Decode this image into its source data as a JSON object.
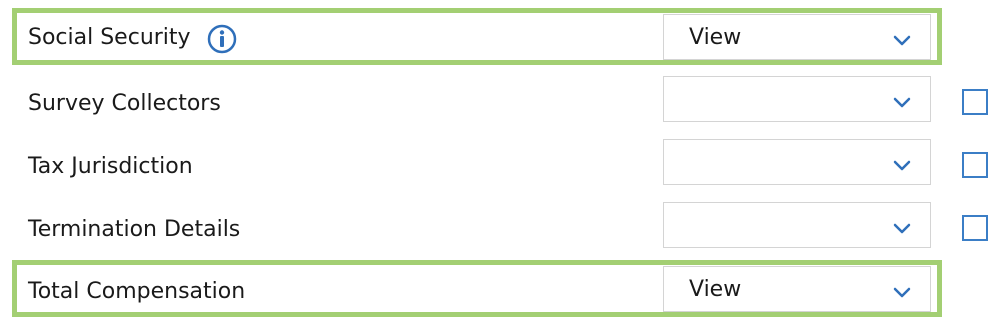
{
  "rows": [
    {
      "label": "Social Security",
      "value": "View",
      "highlighted": true,
      "has_info_icon": true,
      "has_checkbox": false
    },
    {
      "label": "Survey Collectors",
      "value": "",
      "highlighted": false,
      "has_info_icon": false,
      "has_checkbox": true,
      "checked": false
    },
    {
      "label": "Tax Jurisdiction",
      "value": "",
      "highlighted": false,
      "has_info_icon": false,
      "has_checkbox": true,
      "checked": false
    },
    {
      "label": "Termination Details",
      "value": "",
      "highlighted": false,
      "has_info_icon": false,
      "has_checkbox": true,
      "checked": false
    },
    {
      "label": "Total Compensation",
      "value": "View",
      "highlighted": true,
      "has_info_icon": false,
      "has_checkbox": false
    }
  ],
  "colors": {
    "highlight_border": "#a3cf73",
    "accent_blue": "#2f6fba",
    "select_border": "#d4d4d4"
  },
  "icons": {
    "info": "info-icon",
    "dropdown": "chevron-down-icon"
  }
}
